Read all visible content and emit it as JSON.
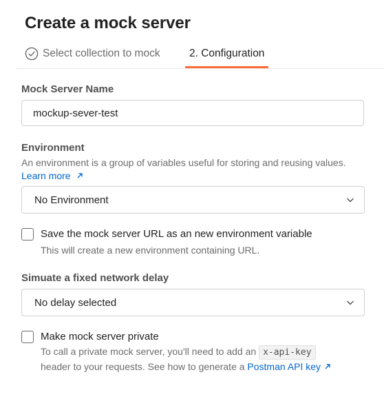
{
  "title": "Create a mock server",
  "steps": [
    {
      "label": "Select collection to mock",
      "status": "completed"
    },
    {
      "label": "2. Configuration",
      "status": "active"
    }
  ],
  "colors": {
    "accent": "#ff6c37",
    "link": "#0265d2"
  },
  "mock_server_name": {
    "label": "Mock Server Name",
    "value": "mockup-sever-test"
  },
  "environment": {
    "label": "Environment",
    "description": "An environment is a group of variables useful for storing and reusing values.",
    "learn_more": "Learn more",
    "selected": "No Environment"
  },
  "save_env_var": {
    "label": "Save the mock server URL as an new environment variable",
    "help": "This will create a new environment containing URL.",
    "checked": false
  },
  "network_delay": {
    "label": "Simuate a fixed network delay",
    "selected": "No delay selected"
  },
  "private": {
    "label": "Make mock server private",
    "help_1": "To call a private mock server, you'll need to add an",
    "code": "x-api-key",
    "help_2": "header to your requests. See how to generate a",
    "link": "Postman API key",
    "checked": false
  }
}
